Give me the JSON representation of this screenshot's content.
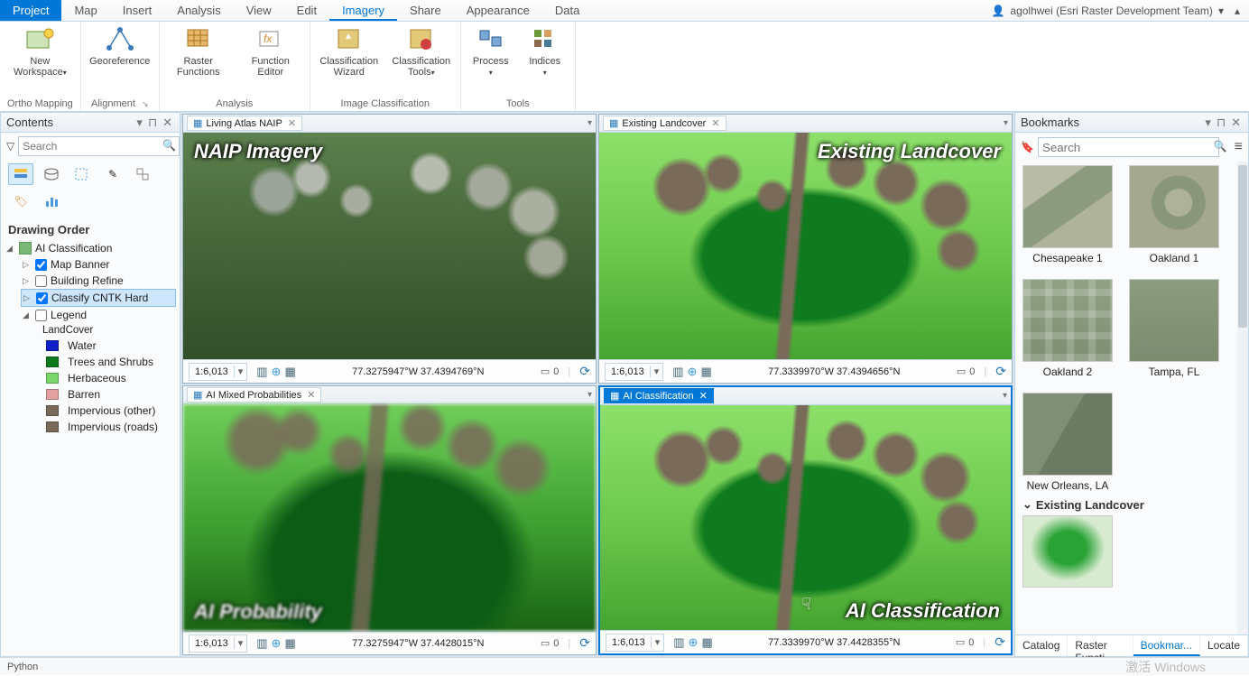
{
  "tabs": {
    "project": "Project",
    "items": [
      "Map",
      "Insert",
      "Analysis",
      "View",
      "Edit",
      "Imagery",
      "Share",
      "Appearance",
      "Data"
    ],
    "active": "Imagery"
  },
  "user": {
    "name": "agolhwei (Esri Raster Development Team)"
  },
  "ribbon": {
    "groups": [
      {
        "label": "Ortho Mapping",
        "launcher": false,
        "items": [
          {
            "label": "New\nWorkspace",
            "arrow": true,
            "icon": "workspace"
          }
        ]
      },
      {
        "label": "Alignment",
        "launcher": true,
        "items": [
          {
            "label": "Georeference",
            "icon": "georef"
          }
        ]
      },
      {
        "label": "Analysis",
        "items": [
          {
            "label": "Raster\nFunctions",
            "icon": "rasterfx"
          },
          {
            "label": "Function\nEditor",
            "icon": "funceditor"
          }
        ]
      },
      {
        "label": "Image Classification",
        "items": [
          {
            "label": "Classification\nWizard",
            "icon": "wizard"
          },
          {
            "label": "Classification\nTools",
            "arrow": true,
            "icon": "clstools"
          }
        ]
      },
      {
        "label": "Tools",
        "items": [
          {
            "label": "Process",
            "arrow": true,
            "icon": "process"
          },
          {
            "label": "Indices",
            "arrow": true,
            "icon": "indices"
          }
        ]
      }
    ]
  },
  "contents": {
    "title": "Contents",
    "search_placeholder": "Search",
    "drawing_order": "Drawing Order",
    "root": "AI Classification",
    "layers": [
      {
        "label": "Map Banner",
        "checked": true
      },
      {
        "label": "Building Refine",
        "checked": false
      },
      {
        "label": "Classify CNTK Hard",
        "checked": true,
        "selected": true
      }
    ],
    "legend": {
      "label": "Legend",
      "group": "LandCover",
      "items": [
        {
          "label": "Water",
          "color": "#1020c8"
        },
        {
          "label": "Trees and Shrubs",
          "color": "#0a7a1c"
        },
        {
          "label": "Herbaceous",
          "color": "#78d66a"
        },
        {
          "label": "Barren",
          "color": "#e3a0a0"
        },
        {
          "label": "Impervious (other)",
          "color": "#7a6a5a"
        },
        {
          "label": "Impervious (roads)",
          "color": "#7a6a5a"
        }
      ]
    }
  },
  "maps": [
    {
      "tab": "Living Atlas NAIP",
      "overlay": "NAIP Imagery",
      "overlay_pos": "tl",
      "scale": "1:6,013",
      "coords": "77.3275947°W 37.4394769°N",
      "sel": "0",
      "kind": "naip"
    },
    {
      "tab": "Existing Landcover",
      "overlay": "Existing Landcover",
      "overlay_pos": "tr",
      "scale": "1:6,013",
      "coords": "77.3339970°W 37.4394656°N",
      "sel": "0",
      "kind": "lc"
    },
    {
      "tab": "AI Mixed Probabilities",
      "overlay": "AI  Probability",
      "overlay_pos": "bl",
      "scale": "1:6,013",
      "coords": "77.3275947°W 37.4428015°N",
      "sel": "0",
      "kind": "prob"
    },
    {
      "tab": "AI Classification",
      "overlay": "AI  Classification",
      "overlay_pos": "br",
      "scale": "1:6,013",
      "coords": "77.3339970°W 37.4428355°N",
      "sel": "0",
      "kind": "lc",
      "active": true
    }
  ],
  "bookmarks": {
    "title": "Bookmarks",
    "search_placeholder": "Search",
    "items": [
      {
        "label": "Chesapeake 1",
        "t": "t1"
      },
      {
        "label": "Oakland 1",
        "t": "t2"
      },
      {
        "label": "Oakland 2",
        "t": "t3"
      },
      {
        "label": "Tampa, FL",
        "t": "t4"
      },
      {
        "label": "New Orleans, LA",
        "t": "t5"
      }
    ],
    "section": "Existing Landcover",
    "bottom_tabs": [
      "Catalog",
      "Raster Functi...",
      "Bookmar...",
      "Locate"
    ],
    "bottom_active": "Bookmar..."
  },
  "status": {
    "left": "Python",
    "activate": "激活 Windows"
  }
}
